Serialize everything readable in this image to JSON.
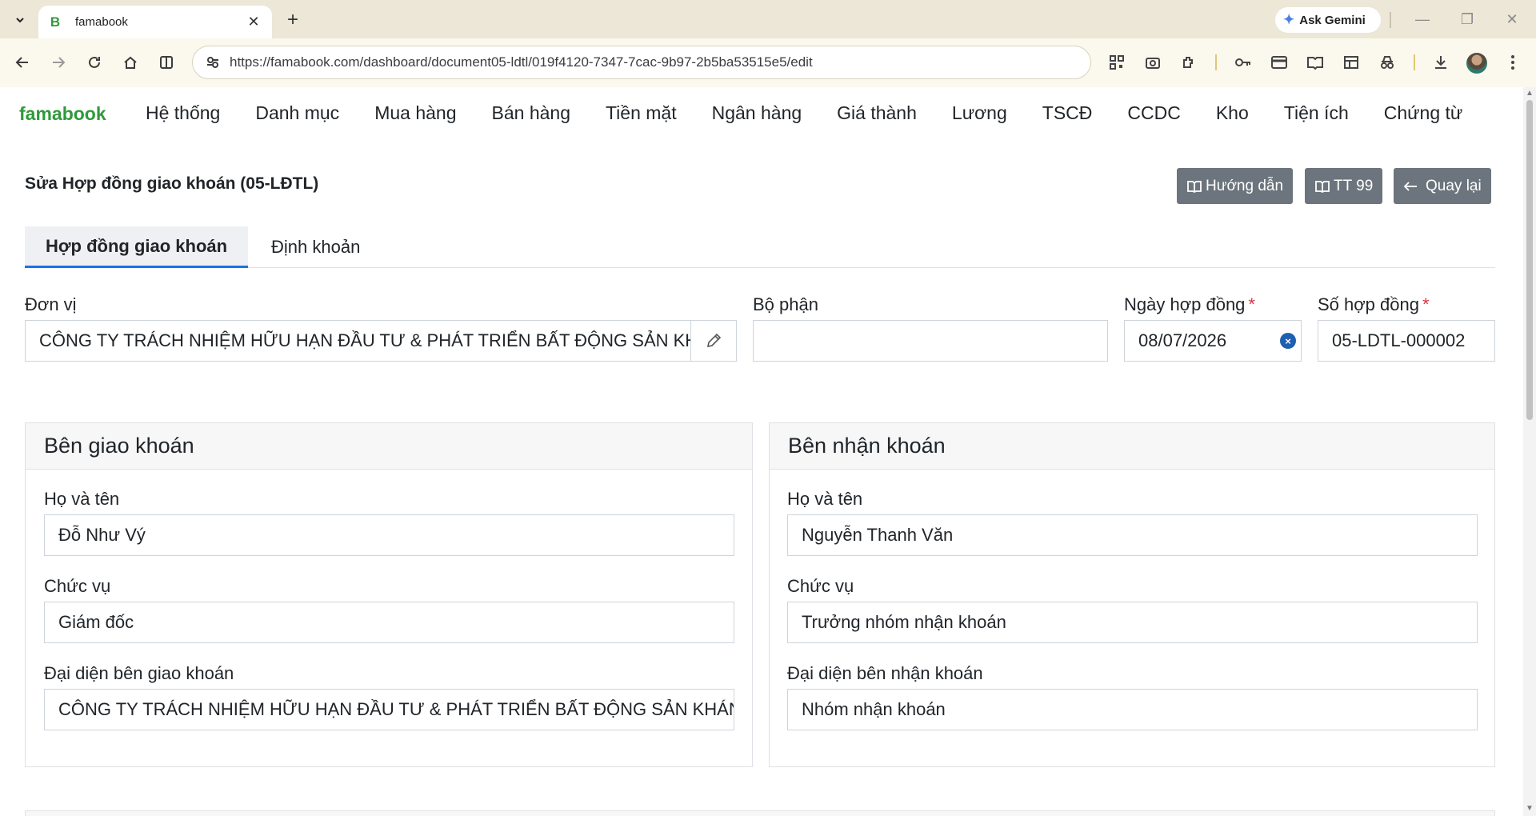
{
  "browser": {
    "tab_title": "famabook",
    "tab_favicon": "B",
    "url": "https://famabook.com/dashboard/document05-ldtl/019f4120-7347-7cac-9b97-2b5ba53515e5/edit",
    "gemini_label": "Ask Gemini"
  },
  "app": {
    "brand": "famabook",
    "menu": [
      "Hệ thống",
      "Danh mục",
      "Mua hàng",
      "Bán hàng",
      "Tiền mặt",
      "Ngân hàng",
      "Giá thành",
      "Lương",
      "TSCĐ",
      "CCDC",
      "Kho",
      "Tiện ích",
      "Chứng từ"
    ]
  },
  "page": {
    "title": "Sửa Hợp đồng giao khoán (05-LĐTL)",
    "actions": {
      "guide": "Hướng dẫn",
      "tt99": "TT 99",
      "back": "Quay lại"
    },
    "tabs": [
      "Hợp đồng giao khoán",
      "Định khoản"
    ]
  },
  "form": {
    "don_vi": {
      "label": "Đơn vị",
      "value": "CÔNG TY TRÁCH NHIỆM HỮU HẠN ĐẦU TƯ & PHÁT TRIỂN BẤT ĐỘNG SẢN KHÁNH LINH"
    },
    "bo_phan": {
      "label": "Bộ phận",
      "value": ""
    },
    "ngay_hop_dong": {
      "label": "Ngày hợp đồng",
      "required": "*",
      "value": "08/07/2026"
    },
    "so_hop_dong": {
      "label": "Số hợp đồng",
      "required": "*",
      "value": "05-LDTL-000002"
    }
  },
  "ben_giao": {
    "header": "Bên giao khoán",
    "ho_ten_label": "Họ và tên",
    "ho_ten": "Đỗ Như Vý",
    "chuc_vu_label": "Chức vụ",
    "chuc_vu": "Giám đốc",
    "dai_dien_label": "Đại diện bên giao khoán",
    "dai_dien": "CÔNG TY TRÁCH NHIỆM HỮU HẠN ĐẦU TƯ & PHÁT TRIỂN BẤT ĐỘNG SẢN KHÁNH LINH"
  },
  "ben_nhan": {
    "header": "Bên nhận khoán",
    "ho_ten_label": "Họ và tên",
    "ho_ten": "Nguyễn Thanh Văn",
    "chuc_vu_label": "Chức vụ",
    "chuc_vu": "Trưởng nhóm nhận khoán",
    "dai_dien_label": "Đại diện bên nhận khoán",
    "dai_dien": "Nhóm nhận khoán"
  },
  "colors": {
    "brand": "#2e9a3a",
    "button": "#6c757d",
    "required": "#dc3545",
    "tab_active_border": "#1a73e8"
  }
}
